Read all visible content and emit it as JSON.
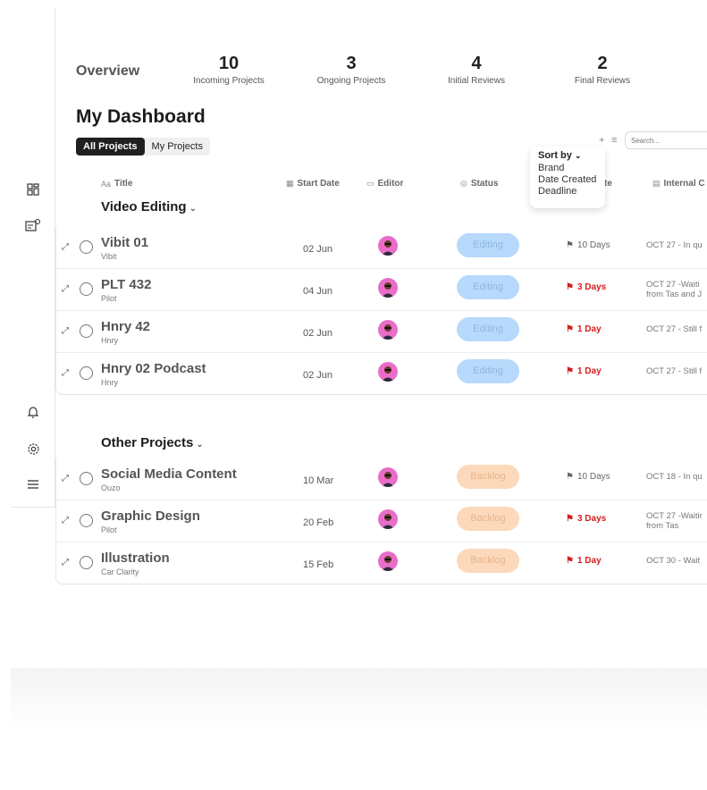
{
  "overview": {
    "title": "Overview",
    "stats": [
      {
        "value": "10",
        "label": "Incoming Projects"
      },
      {
        "value": "3",
        "label": "Ongoing Projects"
      },
      {
        "value": "4",
        "label": "Initial Reviews"
      },
      {
        "value": "2",
        "label": "Final Reviews"
      }
    ]
  },
  "dashboard": {
    "title": "My Dashboard",
    "tabs": [
      {
        "label": "All Projects",
        "active": true
      },
      {
        "label": "My Projects",
        "active": false
      }
    ],
    "toolbar": {
      "add": "+",
      "sort": "≡",
      "search_placeholder": "Search..."
    }
  },
  "columns": {
    "title": "Title",
    "start_date": "Start Date",
    "editor": "Editor",
    "status": "Status",
    "due_tail": "te",
    "internal": "Internal C"
  },
  "sort_menu": {
    "title": "Sort by",
    "options": [
      "Brand",
      "Date Created",
      "Deadline"
    ]
  },
  "groups": [
    {
      "title": "Video Editing",
      "rows": [
        {
          "title": "Vibit 01",
          "brand": "Vibit",
          "date": "02 Jun",
          "status": "Editing",
          "due": "10 Days",
          "late": false,
          "note": "OCT 27 - In qu"
        },
        {
          "title": "PLT 432",
          "brand": "Pilot",
          "date": "04 Jun",
          "status": "Editing",
          "due": "3 Days",
          "late": true,
          "note": "OCT 27 -Waiti",
          "note2": "from Tas and J"
        },
        {
          "title": "Hnry 42",
          "brand": "Hnry",
          "date": "02 Jun",
          "status": "Editing",
          "due": "1 Day",
          "late": true,
          "note": "OCT 27 - Still f"
        },
        {
          "title": "Hnry 02 Podcast",
          "brand": "Hnry",
          "date": "02  Jun",
          "status": "Editing",
          "due": "1 Day",
          "late": true,
          "note": "OCT 27 - Still f"
        }
      ]
    },
    {
      "title": "Other Projects",
      "rows": [
        {
          "title": "Social Media Content",
          "brand": "Ouzo",
          "date": "10 Mar",
          "status": "Backlog",
          "due": "10 Days",
          "late": false,
          "note": "OCT 18 - In qu"
        },
        {
          "title": "Graphic Design",
          "brand": "Pilot",
          "date": "20 Feb",
          "status": "Backlog",
          "due": "3 Days",
          "late": true,
          "note": "OCT 27 -Waitir",
          "note2": "from Tas"
        },
        {
          "title": "Illustration",
          "brand": "Car Clarity",
          "date": "15 Feb",
          "status": "Backlog",
          "due": "1 Day",
          "late": true,
          "note": "OCT 30 - Wait"
        }
      ]
    }
  ],
  "colors": {
    "editing": "#b7d9fb",
    "backlog": "#fcd9bb",
    "late": "#d61d1d",
    "avatar": "#e86dc9"
  }
}
